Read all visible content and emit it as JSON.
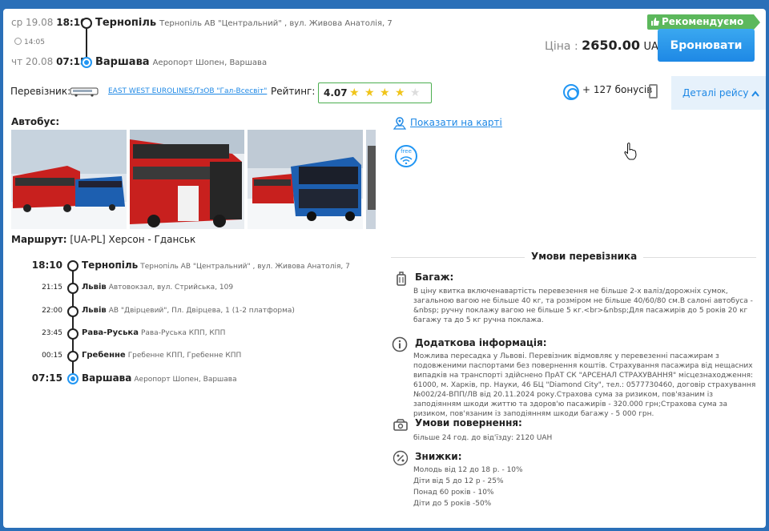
{
  "badge": {
    "recommended": "Рекомендуємо"
  },
  "departure": {
    "date": "ср 19.08",
    "time": "18:10",
    "city": "Тернопіль",
    "address": "Тернопіль АВ \"Центральний\" , вул. Живова Анатолія, 7"
  },
  "duration": "14:05",
  "arrival": {
    "date": "чт 20.08",
    "time": "07:15",
    "city": "Варшава",
    "address": "Аеропорт Шопен, Варшава"
  },
  "price": {
    "label": "Ціна :",
    "value": "2650.00",
    "currency": "UAH"
  },
  "book_button": "Бронювати",
  "carrier": {
    "label": "Перевізник:",
    "name": "EAST WEST EUROLINES/ТзОВ \"Гал-Всесвіт\""
  },
  "rating": {
    "label": "Рейтинг:",
    "value": "4.07",
    "stars": 4,
    "max": 5
  },
  "bonus": "+ 127 бонусів",
  "details_button": "Деталі рейсу",
  "bus_label": "Автобус:",
  "map_link": "Показати на карті",
  "wifi_badge": "free",
  "route": {
    "label": "Маршрут:",
    "value": "[UA-PL] Херсон - Гданськ"
  },
  "stops": [
    {
      "time": "18:10",
      "name": "Тернопіль",
      "address": "Тернопіль АВ \"Центральний\" , вул. Живова Анатолія, 7"
    },
    {
      "time": "21:15",
      "name": "Львів",
      "address": "Автовокзал, вул. Стрийська, 109"
    },
    {
      "time": "22:00",
      "name": "Львів",
      "address": "АВ \"Двірцевий\", Пл. Двірцева, 1 (1-2 платформа)"
    },
    {
      "time": "23:45",
      "name": "Рава-Руська",
      "address": "Рава-Руська КПП, КПП"
    },
    {
      "time": "00:15",
      "name": "Гребенне",
      "address": "Гребенне КПП, Гребенне КПП"
    },
    {
      "time": "07:15",
      "name": "Варшава",
      "address": "Аеропорт Шопен, Варшава"
    }
  ],
  "conditions": {
    "title": "Умови перевізника",
    "baggage": {
      "title": "Багаж:",
      "text": "В ціну квитка включенавартість перевезення не більше 2-х валіз/дорожніх сумок, загальною вагою не більше 40 кг, та розміром не більше 40/60/80 см.В салоні автобуса -&nbsp; ручну поклажу вагою не більше 5 кг.<br>&nbsp;Для пасажирів до 5 років 20 кг багажу та до 5 кг ручна поклажа."
    },
    "info": {
      "title": "Додаткова інформація:",
      "text": "Можлива пересадка у Львові. Перевізник відмовляє у перевезенні пасажирам з подовженими паспортами без повернення коштів. Страхування пасажира від нещасних випадків на транспорті здійснено ПрАТ СК \"АРСЕНАЛ СТРАХУВАННЯ\" місцезнаходження: 61000, м. Харків, пр. Науки, 46 БЦ \"Diamond City\", тел.: 0577730460, договір страхування №002/24-ВПП/ЛВ від 20.11.2024 року.Страхова сума за ризиком, пов'язаним із заподіянням шкоди життю та здоров'ю пасажирів - 320.000 грн;Страхова сума за ризиком, пов'язаним із заподіянням шкоди багажу - 5 000 грн."
    },
    "refund": {
      "title": "Умови повернення:",
      "text": "більше 24 год. до від'їзду: 2120 UAH"
    },
    "discounts": {
      "title": "Знижки:",
      "items": [
        "Молодь від 12 до 18 р. - 10%",
        "Діти від 5 до 12 р - 25%",
        "Понад 60 років - 10%",
        "Діти до 5 років -50%"
      ]
    }
  },
  "colors": {
    "accent": "#1e88e5",
    "badge": "#5cb85c",
    "background": "#2a6fb8"
  }
}
